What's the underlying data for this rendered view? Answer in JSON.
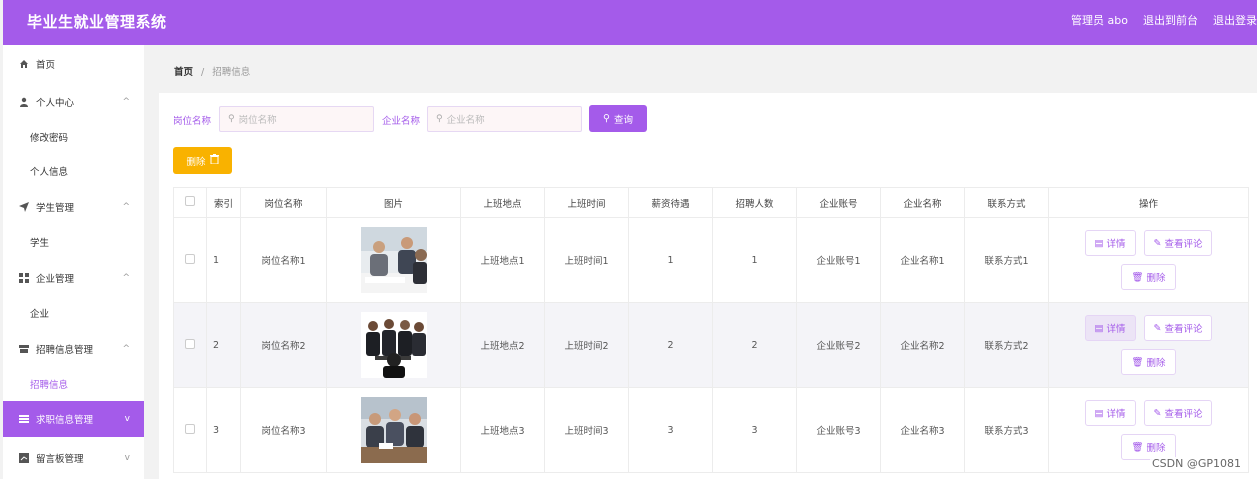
{
  "header": {
    "title": "毕业生就业管理系统",
    "links": [
      "管理员 abo",
      "退出到前台",
      "退出登录"
    ]
  },
  "sidebar": {
    "items": [
      {
        "label": "首页",
        "icon": "home-icon"
      },
      {
        "label": "个人中心",
        "icon": "user-icon",
        "expandable": true
      },
      {
        "label": "修改密码",
        "sub": true
      },
      {
        "label": "个人信息",
        "sub": true
      },
      {
        "label": "学生管理",
        "icon": "send-icon",
        "expandable": true
      },
      {
        "label": "学生",
        "sub": true
      },
      {
        "label": "企业管理",
        "icon": "grid-icon",
        "expandable": true
      },
      {
        "label": "企业",
        "sub": true
      },
      {
        "label": "招聘信息管理",
        "icon": "folder-icon",
        "expandable": true
      },
      {
        "label": "招聘信息",
        "sub": true,
        "active": true
      },
      {
        "label": "求职信息管理",
        "icon": "menu-icon",
        "expandable": true,
        "hover": true
      },
      {
        "label": "留言板管理",
        "icon": "board-icon",
        "expandable": true
      }
    ]
  },
  "breadcrumb": {
    "home": "首页",
    "separator": "/",
    "current": "招聘信息"
  },
  "search": {
    "job_label": "岗位名称",
    "job_placeholder": "岗位名称",
    "company_label": "企业名称",
    "company_placeholder": "企业名称",
    "query_label": "查询"
  },
  "toolbar": {
    "delete_label": "删除"
  },
  "table": {
    "headers": [
      "索引",
      "岗位名称",
      "图片",
      "上班地点",
      "上班时间",
      "薪资待遇",
      "招聘人数",
      "企业账号",
      "企业名称",
      "联系方式",
      "操作"
    ],
    "rows": [
      {
        "index": "1",
        "job": "岗位名称1",
        "place": "上班地点1",
        "time": "上班时间1",
        "salary": "1",
        "count": "1",
        "account": "企业账号1",
        "company": "企业名称1",
        "contact": "联系方式1"
      },
      {
        "index": "2",
        "job": "岗位名称2",
        "place": "上班地点2",
        "time": "上班时间2",
        "salary": "2",
        "count": "2",
        "account": "企业账号2",
        "company": "企业名称2",
        "contact": "联系方式2"
      },
      {
        "index": "3",
        "job": "岗位名称3",
        "place": "上班地点3",
        "time": "上班时间3",
        "salary": "3",
        "count": "3",
        "account": "企业账号3",
        "company": "企业名称3",
        "contact": "联系方式3"
      }
    ],
    "actions": {
      "detail": "详情",
      "comments": "查看评论",
      "delete": "删除"
    }
  },
  "watermark": "CSDN @GP1081",
  "colors": {
    "accent": "#a45bea",
    "warning": "#f9b200"
  }
}
